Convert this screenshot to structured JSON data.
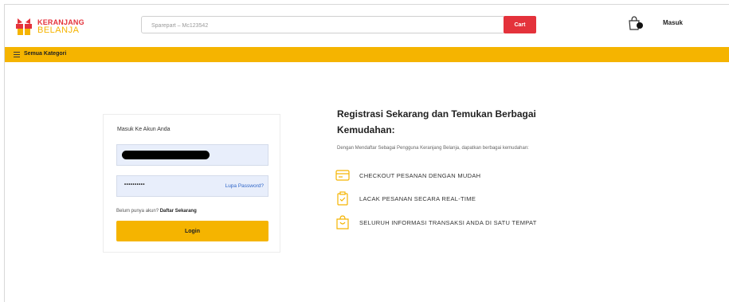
{
  "brand": {
    "name_line1": "KERANJANG",
    "name_line2": "BELANJA"
  },
  "header": {
    "search_placeholder": "Sparepart – Mc123542",
    "cart_label": "Cart",
    "login_label": "Masuk"
  },
  "category_bar": {
    "label": "Semua Kategori"
  },
  "login_form": {
    "title": "Masuk Ke Akun Anda",
    "password_mask": "••••••••••",
    "forgot_password": "Lupa Password?",
    "no_account_text": "Belum punya akun?",
    "register_link": "Daftar Sekarang",
    "login_button": "Login"
  },
  "registration": {
    "title": "Registrasi Sekarang dan Temukan Berbagai Kemudahan:",
    "description": "Dengan Mendaftar Sebagai Pengguna Keranjang Belanja, dapatkan berbagai kemudahan:",
    "features": [
      {
        "icon": "card-icon",
        "text": "CHECKOUT PESANAN DENGAN MUDAH"
      },
      {
        "icon": "clipboard-check-icon",
        "text": "LACAK PESANAN SECARA REAL-TIME"
      },
      {
        "icon": "shopping-bag-icon",
        "text": "SELURUH INFORMASI TRANSAKSI ANDA DI SATU TEMPAT"
      }
    ]
  },
  "colors": {
    "accent_yellow": "#f5b400",
    "brand_red": "#e4323b",
    "link_blue": "#2f66c8",
    "input_bg": "#e8eefb"
  }
}
